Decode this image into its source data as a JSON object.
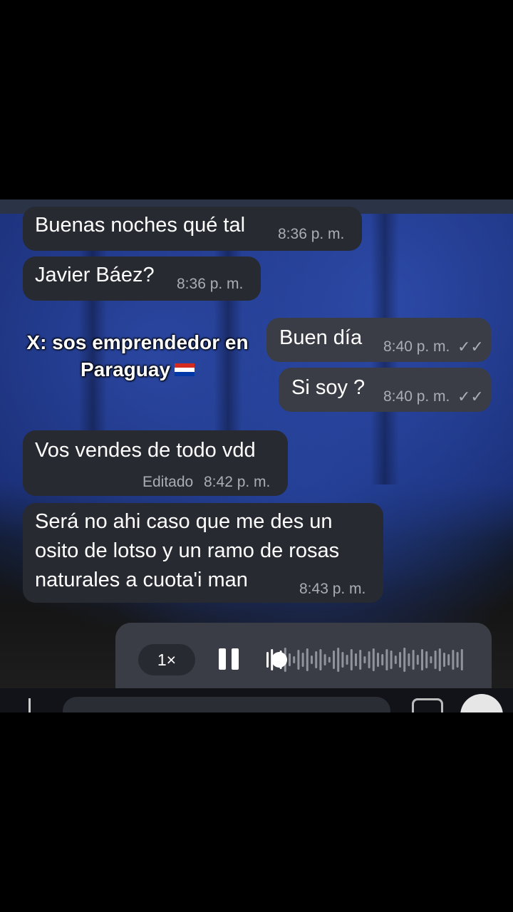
{
  "caption": {
    "line1": "X: sos emprendedor en",
    "line2": "Paraguay"
  },
  "messages": [
    {
      "text": "Buenas noches qué tal",
      "time": "8:36 p. m."
    },
    {
      "text": "Javier Báez?",
      "time": "8:36 p. m."
    },
    {
      "text": "Buen día",
      "time": "8:40 p. m.",
      "status": "✓✓"
    },
    {
      "text": "Si soy ?",
      "time": "8:40 p. m.",
      "status": "✓✓"
    },
    {
      "text": "Vos vendes de todo vdd",
      "edited": "Editado",
      "time": "8:42 p. m."
    },
    {
      "lines": [
        "Será no ahi caso que me des un",
        "osito de lotso y un ramo de rosas",
        "naturales a cuota'i man"
      ],
      "time": "8:43 p. m."
    }
  ],
  "audio": {
    "speed": "1×"
  },
  "icons": {
    "pause": "pause-icon",
    "waveform": "waveform-icon",
    "camera": "camera-icon",
    "mic": "microphone-icon"
  },
  "colors": {
    "incoming_bubble": "#272a31",
    "outgoing_bubble": "#3a3d45",
    "background": "#16286a"
  }
}
